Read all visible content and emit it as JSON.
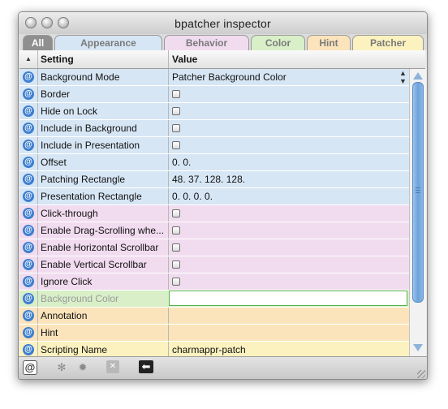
{
  "window": {
    "title": "bpatcher inspector"
  },
  "tabs": {
    "all": "All",
    "appearance": "Appearance",
    "behavior": "Behavior",
    "color": "Color",
    "hint": "Hint",
    "patcher": "Patcher"
  },
  "header": {
    "setting": "Setting",
    "value": "Value",
    "sort_glyph": "▲"
  },
  "rows": [
    {
      "setting": "Background Mode",
      "value": "Patcher Background Color"
    },
    {
      "setting": "Border",
      "value": ""
    },
    {
      "setting": "Hide on Lock",
      "value": ""
    },
    {
      "setting": "Include in Background",
      "value": ""
    },
    {
      "setting": "Include in Presentation",
      "value": ""
    },
    {
      "setting": "Offset",
      "value": "0. 0."
    },
    {
      "setting": "Patching Rectangle",
      "value": "48. 37. 128. 128."
    },
    {
      "setting": "Presentation Rectangle",
      "value": "0. 0. 0. 0."
    },
    {
      "setting": "Click-through",
      "value": ""
    },
    {
      "setting": "Enable Drag-Scrolling whe...",
      "value": ""
    },
    {
      "setting": "Enable Horizontal Scrollbar",
      "value": ""
    },
    {
      "setting": "Enable Vertical Scrollbar",
      "value": ""
    },
    {
      "setting": "Ignore Click",
      "value": ""
    },
    {
      "setting": "Background Color",
      "value": ""
    },
    {
      "setting": "Annotation",
      "value": ""
    },
    {
      "setting": "Hint",
      "value": ""
    },
    {
      "setting": "Scripting Name",
      "value": "charmappr-patch"
    }
  ],
  "row_icon": "@",
  "colors": {
    "appearance": "#d7e6f5",
    "behavior": "#f1dcef",
    "color": "#d8efc8",
    "hint": "#fbe4bb",
    "patcher": "#fbf2bf",
    "all": "#8f8f8f"
  },
  "bottombar": {
    "at": "@",
    "star1": "✻",
    "star2": "✹",
    "x": "✕",
    "arrow": "⬅"
  }
}
